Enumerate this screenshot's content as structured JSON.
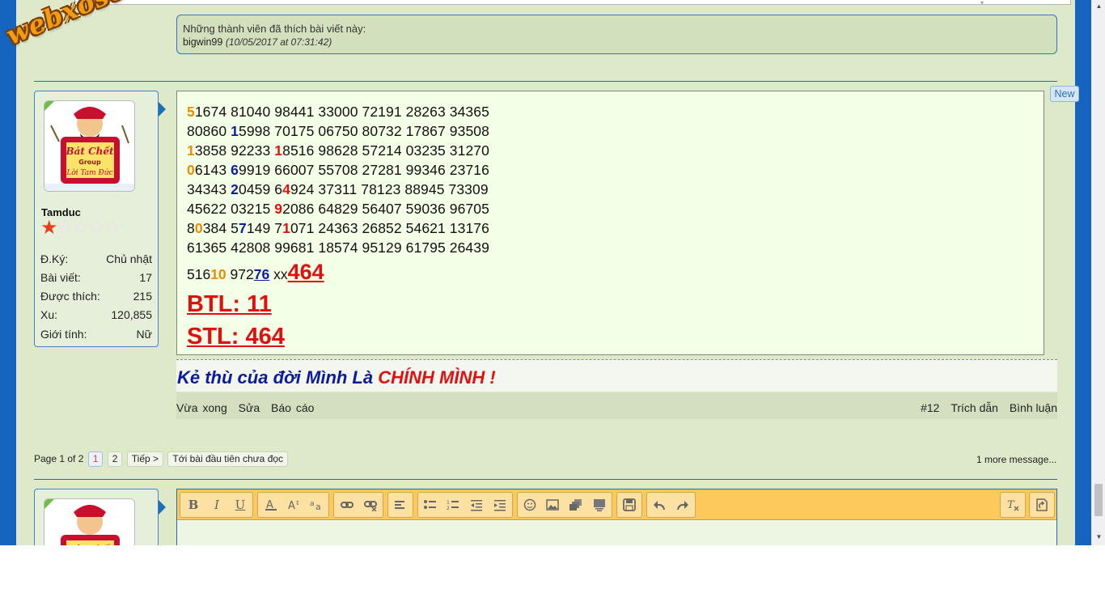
{
  "site": {
    "watermark": "webxoso.net",
    "top_caret": "▾"
  },
  "likes": {
    "title": "Những thành viên đã thích bài viết này:",
    "user": "bigwin99",
    "date": "(10/05/2017 at 07:31:42)"
  },
  "author": {
    "name": "Tamduc",
    "rating_stars": 1,
    "rating_max": 5,
    "avatar_text": [
      "Bát Chết",
      "Group",
      "Lời Tam Đức"
    ],
    "stats": [
      {
        "label": "Đ.Ký:",
        "value": "Chủ nhật"
      },
      {
        "label": "Bài viết:",
        "value": "17"
      },
      {
        "label": "Được thích:",
        "value": "215"
      },
      {
        "label": "Xu:",
        "value": "120,855"
      },
      {
        "label": "Giới tính:",
        "value": "Nữ"
      }
    ]
  },
  "post": {
    "new_badge": "New",
    "lines": [
      [
        {
          "t": "5",
          "c": "o"
        },
        {
          "t": "1674 81040 98441 33000 72191 28263 34365"
        }
      ],
      [
        {
          "t": "80860 "
        },
        {
          "t": "1",
          "c": "b"
        },
        {
          "t": "5998 70175 06750 80732 17867 93508"
        }
      ],
      [
        {
          "t": "1",
          "c": "o"
        },
        {
          "t": "3858 92233 "
        },
        {
          "t": "1",
          "c": "r"
        },
        {
          "t": "8516 98628 57214 03235 31270"
        }
      ],
      [
        {
          "t": "0",
          "c": "o"
        },
        {
          "t": "6143 "
        },
        {
          "t": "6",
          "c": "b"
        },
        {
          "t": "9919 66007 55708 27281 99346 23716"
        }
      ],
      [
        {
          "t": "34343 "
        },
        {
          "t": "2",
          "c": "b"
        },
        {
          "t": "0459 6"
        },
        {
          "t": "4",
          "c": "r"
        },
        {
          "t": "924 37311 78123 88945 73309"
        }
      ],
      [
        {
          "t": "45622 03215 "
        },
        {
          "t": "9",
          "c": "r"
        },
        {
          "t": "2086 64829 56407 59036 96705"
        }
      ],
      [
        {
          "t": "8"
        },
        {
          "t": "0",
          "c": "o"
        },
        {
          "t": "384 5"
        },
        {
          "t": "7",
          "c": "b"
        },
        {
          "t": "149 7"
        },
        {
          "t": "1",
          "c": "r"
        },
        {
          "t": "071 24363 26852 54621 13176"
        }
      ],
      [
        {
          "t": "61365 42808 99681 18574 95129 61795 26439"
        }
      ]
    ],
    "special": {
      "p1": "516",
      "p2": "10",
      "p3": " 972",
      "p4": "76",
      "p5": " xx",
      "p6": "464"
    },
    "btl": "BTL: 11",
    "stl": "STL: 464"
  },
  "signature": {
    "blue": "Kẻ thù của đời Mình Là ",
    "red": "CHÍNH MÌNH !"
  },
  "actions": {
    "time": "Vừa xong",
    "edit": "Sửa",
    "report": "Báo cáo",
    "post_no": "#12",
    "quote": "Trích dẫn",
    "comment": "Bình luận"
  },
  "pager": {
    "label": "Page 1 of 2",
    "pages": [
      "1",
      "2"
    ],
    "next": "Tiếp >",
    "first_unread": "Tới bài đầu tiên chưa đọc",
    "more": "1 more message..."
  },
  "editor": {
    "toolbar_groups": [
      [
        "bold-icon",
        "italic-icon",
        "underline-icon"
      ],
      [
        "text-color-icon",
        "font-size-icon",
        "font-family-icon"
      ],
      [
        "link-icon",
        "unlink-icon"
      ],
      [
        "align-icon"
      ],
      [
        "bullet-list-icon",
        "number-list-icon",
        "outdent-icon",
        "indent-icon"
      ],
      [
        "smilie-icon",
        "image-icon",
        "media-icon",
        "code-icon"
      ],
      [
        "save-draft-icon"
      ],
      [
        "undo-icon",
        "redo-icon"
      ]
    ],
    "labels": {
      "bold": "B",
      "italic": "I",
      "underline": "U"
    }
  },
  "colors": {
    "page_bg": "#dde9c9",
    "frame_blue": "#1565c0",
    "accent_red": "#e01010",
    "accent_orange": "#f28a00",
    "accent_navy": "#0b1fa0",
    "toolbar_bg": "#fdc95d"
  }
}
